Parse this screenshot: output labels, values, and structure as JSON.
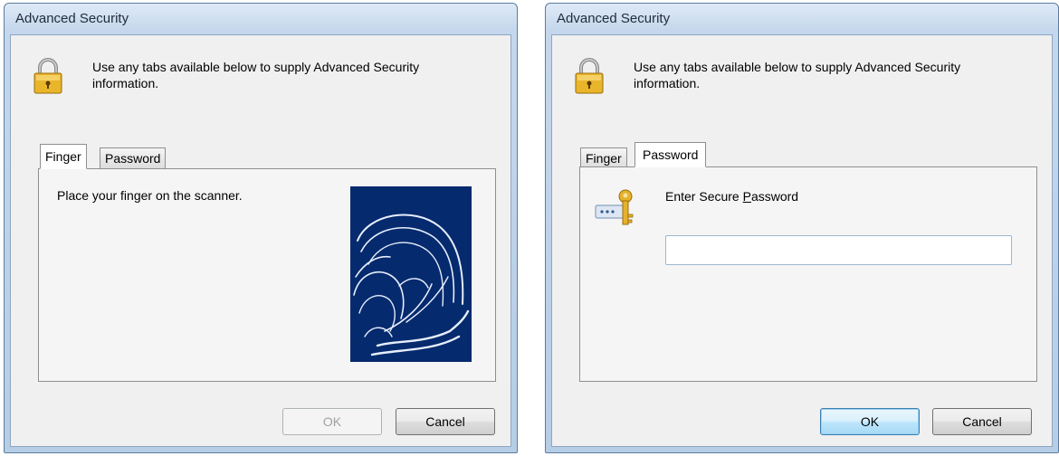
{
  "dialogs": {
    "left": {
      "title": "Advanced Security",
      "header_text": "Use any tabs available below to supply Advanced Security information.",
      "tabs": [
        "Finger",
        "Password"
      ],
      "active_tab": "Finger",
      "finger_prompt": "Place your finger on the scanner.",
      "ok_label": "OK",
      "cancel_label": "Cancel"
    },
    "right": {
      "title": "Advanced Security",
      "header_text": "Use any tabs available below to supply Advanced Security information.",
      "tabs": [
        "Finger",
        "Password"
      ],
      "active_tab": "Password",
      "password_label_pre": "Enter Secure ",
      "password_label_mnemonic": "P",
      "password_label_post": "assword",
      "password_value": "",
      "ok_label": "OK",
      "cancel_label": "Cancel"
    }
  },
  "icons": {
    "lock": "lock-icon",
    "key": "key-icon",
    "fingerprint": "fingerprint-image"
  },
  "colors": {
    "fingerprint_bg": "#062a6e",
    "lock_gold": "#e9b52a",
    "title_gradient_top": "#dfeaf6"
  }
}
